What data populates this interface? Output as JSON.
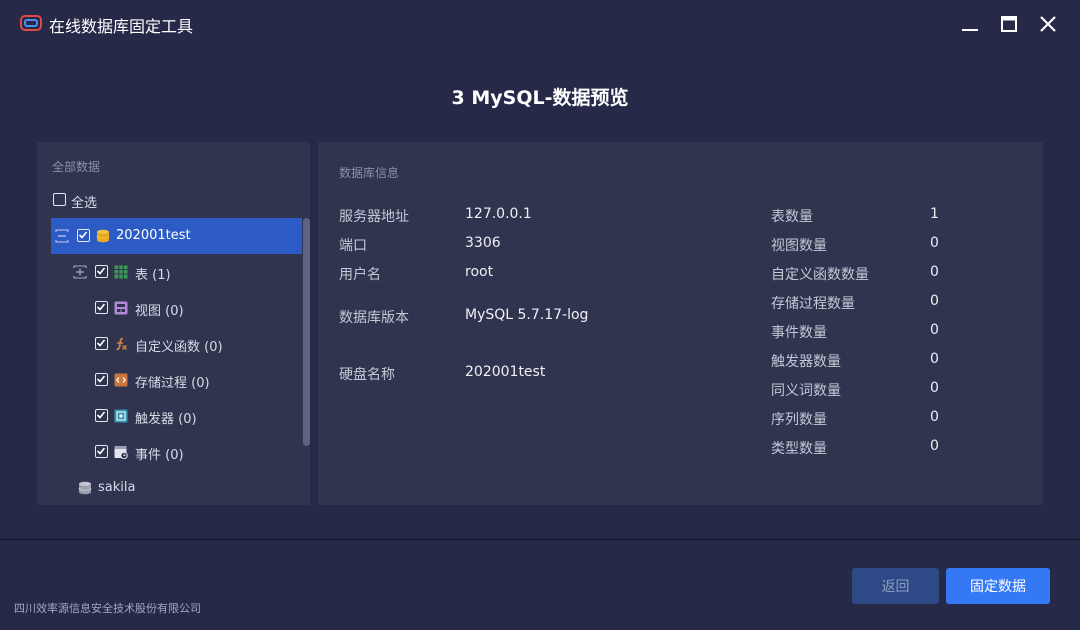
{
  "window": {
    "title": "在线数据库固定工具"
  },
  "step_title": "3 MySQL-数据预览",
  "left_panel": {
    "caption": "全部数据",
    "select_all_label": "全选",
    "tree": {
      "db_selected": "202001test",
      "children": [
        {
          "label": "表 (1)",
          "icon": "table-icon"
        },
        {
          "label": "视图 (0)",
          "icon": "view-icon"
        },
        {
          "label": "自定义函数 (0)",
          "icon": "function-icon"
        },
        {
          "label": "存储过程 (0)",
          "icon": "procedure-icon"
        },
        {
          "label": "触发器 (0)",
          "icon": "trigger-icon"
        },
        {
          "label": "事件 (0)",
          "icon": "event-icon"
        }
      ],
      "db_other": "sakila"
    }
  },
  "right_panel": {
    "caption": "数据库信息",
    "left_info": [
      {
        "label": "服务器地址",
        "value": "127.0.0.1"
      },
      {
        "label": "端口",
        "value": "3306"
      },
      {
        "label": "用户名",
        "value": "root"
      },
      {
        "label": "数据库版本",
        "value": "MySQL 5.7.17-log"
      },
      {
        "label": "硬盘名称",
        "value": "202001test"
      }
    ],
    "right_info": [
      {
        "label": "表数量",
        "value": "1"
      },
      {
        "label": "视图数量",
        "value": "0"
      },
      {
        "label": "自定义函数数量",
        "value": "0"
      },
      {
        "label": "存储过程数量",
        "value": "0"
      },
      {
        "label": "事件数量",
        "value": "0"
      },
      {
        "label": "触发器数量",
        "value": "0"
      },
      {
        "label": "同义词数量",
        "value": "0"
      },
      {
        "label": "序列数量",
        "value": "0"
      },
      {
        "label": "类型数量",
        "value": "0"
      }
    ]
  },
  "footer": {
    "company": "四川效率源信息安全技术股份有限公司",
    "back_label": "返回",
    "fix_label": "固定数据"
  },
  "colors": {
    "background": "#262a48",
    "panel": "#30344f",
    "selected_row": "#2d5bc6",
    "primary_button": "#3478f6",
    "secondary_button": "#2d4a86"
  }
}
